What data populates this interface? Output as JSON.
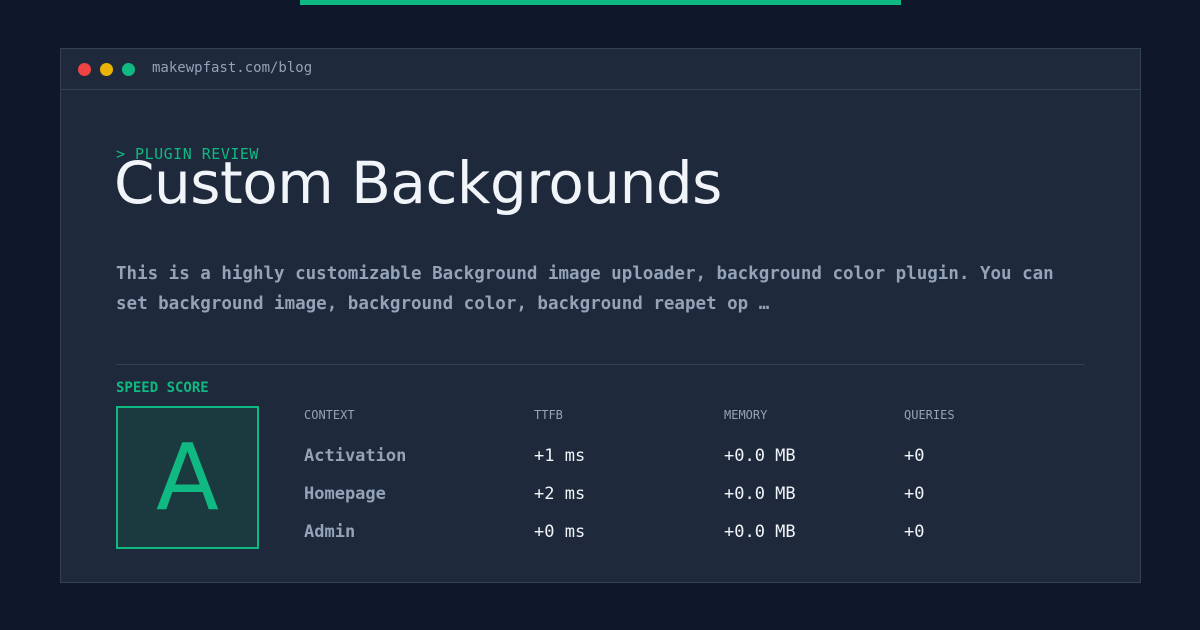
{
  "browser": {
    "url": "makewpfast.com/blog"
  },
  "header": {
    "eyebrow": "> PLUGIN REVIEW",
    "title": "Custom Backgrounds",
    "description": "This is a highly customizable Background image uploader, background color plugin. You can set background image, background color, background reapet op …"
  },
  "score": {
    "label": "SPEED SCORE",
    "grade": "A"
  },
  "table": {
    "headers": [
      "CONTEXT",
      "TTFB",
      "MEMORY",
      "QUERIES"
    ],
    "rows": [
      {
        "context": "Activation",
        "ttfb": "+1 ms",
        "memory": "+0.0 MB",
        "queries": "+0"
      },
      {
        "context": "Homepage",
        "ttfb": "+2 ms",
        "memory": "+0.0 MB",
        "queries": "+0"
      },
      {
        "context": "Admin",
        "ttfb": "+0 ms",
        "memory": "+0.0 MB",
        "queries": "+0"
      }
    ]
  },
  "colors": {
    "background": "#0f172a",
    "card": "#1e293b",
    "accent": "#10b981",
    "muted_text": "#94a3b8",
    "text": "#f1f5f9"
  }
}
